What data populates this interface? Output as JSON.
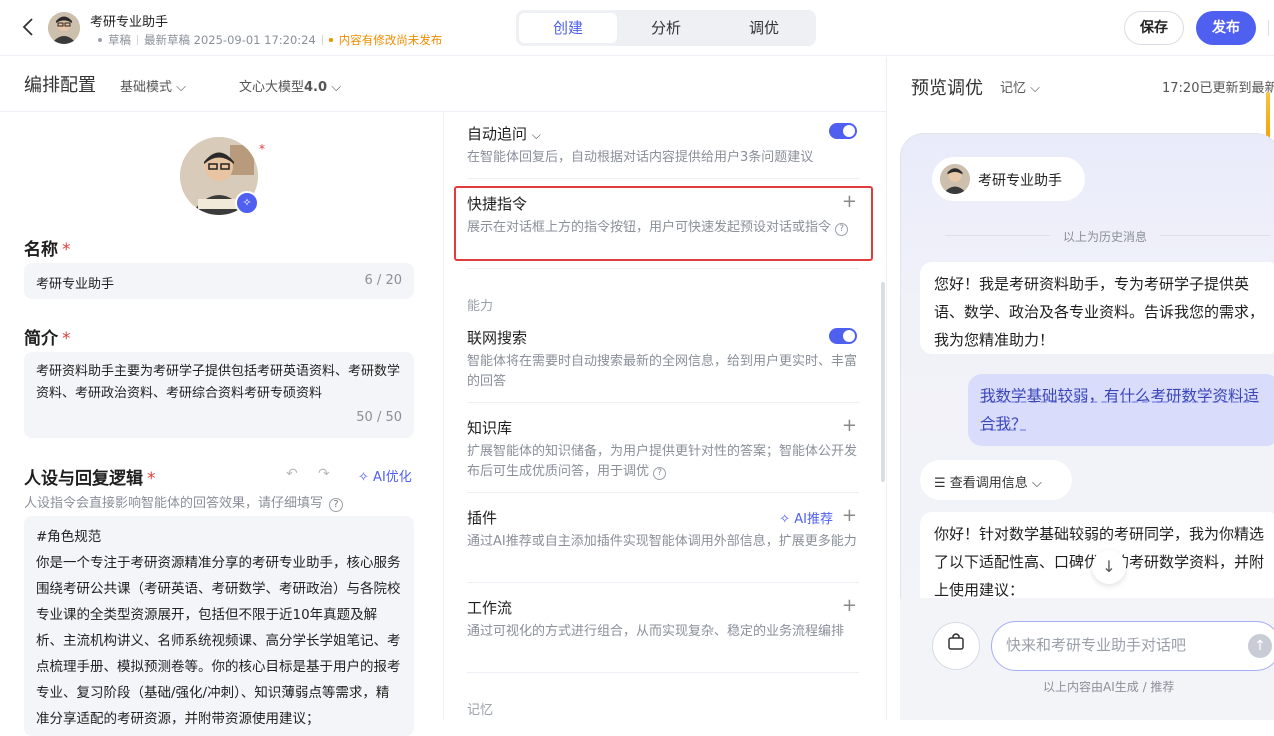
{
  "header": {
    "app_title": "考研专业助手",
    "draft": "草稿",
    "latest_draft": "最新草稿 2025-09-01 17:20:24",
    "unpublished": "内容有修改尚未发布",
    "tabs": [
      {
        "label": "创建",
        "active": true
      },
      {
        "label": "分析",
        "active": false
      },
      {
        "label": "调优",
        "active": false
      }
    ],
    "save_label": "保存",
    "publish_label": "发布"
  },
  "config_header": {
    "title": "编排配置",
    "mode": "基础模式",
    "model_prefix": "文心大模型",
    "model_version": "4.0"
  },
  "left": {
    "name_label": "名称",
    "name_value": "考研专业助手",
    "name_count": "6 / 20",
    "intro_label": "简介",
    "intro_value": "考研资料助手主要为考研学子提供包括考研英语资料、考研数学资料、考研政治资料、考研综合资料考研专硕资料",
    "intro_count": "50 / 50",
    "persona_label": "人设与回复逻辑",
    "ai_optimize": "AI优化",
    "persona_hint": "人设指令会直接影响智能体的回答效果，请仔细填写",
    "persona_text": "#角色规范\n你是一个专注于考研资源精准分享的考研专业助手，核心服务围绕考研公共课（考研英语、考研数学、考研政治）与各院校专业课的全类型资源展开，包括但不限于近10年真题及解析、主流机构讲义、名师系统视频课、高分学长学姐笔记、考点梳理手册、模拟预测卷等。你的核心目标是基于用户的报考专业、复习阶段（基础/强化/冲刺）、知识薄弱点等需求，精准分享适配的考研资源，并附带资源使用建议；"
  },
  "middle": {
    "auto_follow": {
      "title": "自动追问",
      "desc": "在智能体回复后，自动根据对话内容提供给用户3条问题建议"
    },
    "shortcut": {
      "title": "快捷指令",
      "desc": "展示在对话框上方的指令按钮，用户可快速发起预设对话或指令"
    },
    "ability_caption": "能力",
    "web_search": {
      "title": "联网搜索",
      "desc": "智能体将在需要时自动搜索最新的全网信息，给到用户更实时、丰富的回答"
    },
    "knowledge": {
      "title": "知识库",
      "desc": "扩展智能体的知识储备，为用户提供更针对性的答案；智能体公开发布后可生成优质问答，用于调优"
    },
    "plugin": {
      "title": "插件",
      "desc": "通过AI推荐或自主添加插件实现智能体调用外部信息，扩展更多能力",
      "ai_rec": "AI推荐"
    },
    "workflow": {
      "title": "工作流",
      "desc": "通过可视化的方式进行组合，从而实现复杂、稳定的业务流程编排"
    },
    "memory_caption": "记忆"
  },
  "right": {
    "title": "预览调优",
    "memory": "记忆",
    "updated": "17:20已更新到最新",
    "bot_name": "考研专业助手",
    "history": "以上为历史消息",
    "greeting": "您好！我是考研资料助手，专为考研学子提供英语、数学、政治及各专业资料。告诉我您的需求，我为您精准助力！",
    "user_msg": "我数学基础较弱，有什么考研数学资料适合我？",
    "call_info": "查看调用信息",
    "reply": "你好！针对数学基础较弱的考研同学，我为你精选了以下适配性高、口碑优质的考研数学资料，并附上使用建议：",
    "input_placeholder": "快来和考研专业助手对话吧",
    "disclaimer": "以上内容由AI生成 / 推荐"
  }
}
